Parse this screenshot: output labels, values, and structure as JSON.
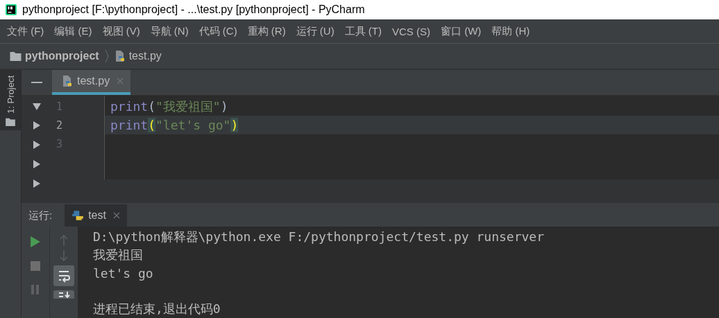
{
  "window": {
    "title": "pythonproject [F:\\pythonproject] - ...\\test.py [pythonproject] - PyCharm"
  },
  "menu": [
    {
      "label": "文件 (F)"
    },
    {
      "label": "编辑 (E)"
    },
    {
      "label": "视图 (V)"
    },
    {
      "label": "导航 (N)"
    },
    {
      "label": "代码 (C)"
    },
    {
      "label": "重构 (R)"
    },
    {
      "label": "运行 (U)"
    },
    {
      "label": "工具 (T)"
    },
    {
      "label": "VCS (S)"
    },
    {
      "label": "窗口 (W)"
    },
    {
      "label": "帮助 (H)"
    }
  ],
  "breadcrumb": [
    "pythonproject",
    "test.py"
  ],
  "tool_stripe": {
    "label": "1: Project",
    "selected": true
  },
  "editor_tabs": [
    {
      "label": "test.py",
      "selected": true
    }
  ],
  "code_lines": [
    {
      "number": "1",
      "current": false,
      "tokens": [
        {
          "kind": "builtin",
          "text": "print"
        },
        {
          "kind": "paren",
          "text": "(",
          "matched": false
        },
        {
          "kind": "string",
          "text": "\"我爱祖国\""
        },
        {
          "kind": "paren",
          "text": ")",
          "matched": false
        }
      ]
    },
    {
      "number": "2",
      "current": true,
      "tokens": [
        {
          "kind": "builtin",
          "text": "print"
        },
        {
          "kind": "paren",
          "text": "(",
          "matched": true
        },
        {
          "kind": "string",
          "text": "\"let's go\""
        },
        {
          "kind": "paren",
          "text": ")",
          "matched": true
        }
      ]
    },
    {
      "number": "3",
      "current": false
    }
  ],
  "run_panel": {
    "label": "运行:",
    "tabs": [
      {
        "label": "test",
        "selected": true
      }
    ],
    "output": [
      {
        "kind": "text",
        "text": "D:\\python解释器\\python.exe F:/pythonproject/test.py runserver"
      },
      {
        "kind": "text",
        "text": "我爱祖国"
      },
      {
        "kind": "text",
        "text": "let's go"
      },
      {
        "kind": "blank"
      },
      {
        "kind": "text",
        "text": "进程已结束,退出代码0"
      }
    ]
  }
}
